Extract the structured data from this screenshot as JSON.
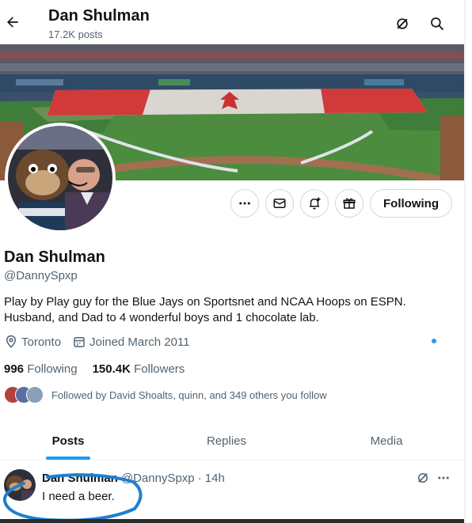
{
  "header": {
    "title": "Dan Shulman",
    "posts_count": "17.2K posts",
    "back_icon": "arrow-left-icon",
    "grok_icon": "grok-icon",
    "search_icon": "search-icon"
  },
  "profile": {
    "name": "Dan Shulman",
    "handle": "@DannySpxp",
    "bio": "Play by Play guy for the Blue Jays on Sportsnet and NCAA Hoops on ESPN. Husband, and Dad to 4 wonderful boys and 1 chocolate lab.",
    "location": "Toronto",
    "joined": "Joined March 2011",
    "following_count": "996",
    "following_label": "Following",
    "followers_count": "150.4K",
    "followers_label": "Followers",
    "followed_by": "Followed by David Shoalts, quinn, and 349 others you follow"
  },
  "actions": {
    "more_icon": "more-icon",
    "message_icon": "envelope-icon",
    "notify_icon": "bell-plus-icon",
    "subscribe_icon": "gift-icon",
    "following_button": "Following"
  },
  "tabs": [
    {
      "label": "Posts",
      "active": true
    },
    {
      "label": "Replies",
      "active": false
    },
    {
      "label": "Media",
      "active": false
    }
  ],
  "tweet": {
    "name": "Dan Shulman",
    "handle": "@DannySpxp",
    "time": "· 14h",
    "text": "I need a beer."
  },
  "colors": {
    "accent": "#1d9bf0",
    "text": "#0f1419",
    "muted": "#536471",
    "scribble": "#1f7fd1"
  }
}
